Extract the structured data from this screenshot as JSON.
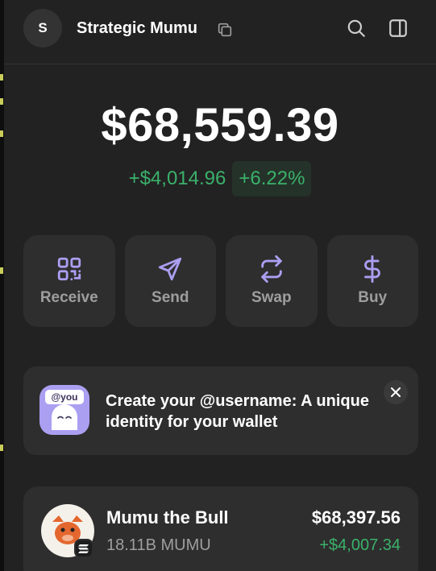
{
  "header": {
    "avatar_letter": "S",
    "account_name": "Strategic Mumu",
    "icons": [
      "copy-icon",
      "search-icon",
      "sidebar-toggle-icon"
    ]
  },
  "portfolio": {
    "balance": "$68,559.39",
    "change_amount": "+$4,014.96",
    "change_percent": "+6.22%"
  },
  "actions": [
    {
      "label": "Receive",
      "icon": "qr-code-icon"
    },
    {
      "label": "Send",
      "icon": "send-icon"
    },
    {
      "label": "Swap",
      "icon": "swap-icon"
    },
    {
      "label": "Buy",
      "icon": "dollar-icon"
    }
  ],
  "promo": {
    "badge_text": "@you",
    "text": "Create your @username: A unique identity for your wallet"
  },
  "tokens": [
    {
      "name": "Mumu the Bull",
      "amount": "18.11B MUMU",
      "value": "$68,397.56",
      "change": "+$4,007.34"
    }
  ],
  "colors": {
    "background": "#222222",
    "card": "#2e2e2e",
    "accent": "#ab9ff2",
    "positive": "#3bb16b",
    "muted_text": "#9e9e9e"
  }
}
